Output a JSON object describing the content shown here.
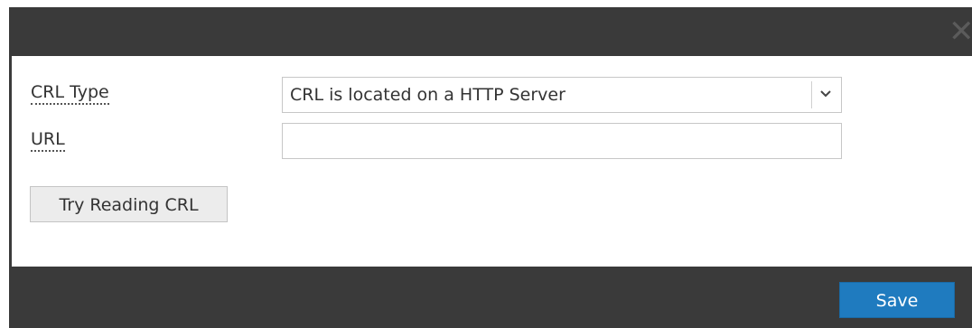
{
  "dialog": {
    "close_glyph": "✕"
  },
  "form": {
    "crl_type_label": "CRL Type",
    "crl_type_value": "CRL is located on a HTTP Server",
    "url_label": "URL",
    "url_value": "",
    "try_reading_label": "Try Reading CRL"
  },
  "footer": {
    "save_label": "Save"
  },
  "colors": {
    "chrome": "#3a3a3a",
    "primary": "#1f7bbf",
    "button_gray": "#ececec"
  },
  "icons": {
    "close": "close-icon",
    "dropdown": "chevron-down-icon"
  }
}
